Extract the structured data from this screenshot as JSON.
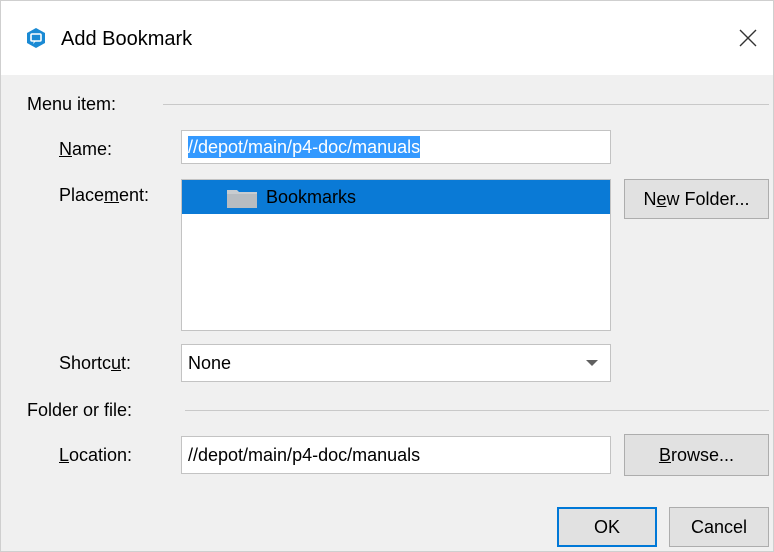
{
  "dialog": {
    "title": "Add Bookmark",
    "icon": "helix-app-icon",
    "close_icon": "close-icon"
  },
  "menu_item_group": {
    "label": "Menu item:",
    "name": {
      "label_pre": "",
      "label_mnemonic": "N",
      "label_post": "ame:",
      "value": "//depot/main/p4-doc/manuals"
    },
    "placement": {
      "label_pre": "Place",
      "label_mnemonic": "m",
      "label_post": "ent:",
      "items": [
        {
          "label": "Bookmarks",
          "icon": "folder-icon",
          "selected": true
        }
      ]
    },
    "new_folder_button": {
      "label_pre": "N",
      "label_mnemonic": "e",
      "label_post": "w Folder..."
    },
    "shortcut": {
      "label_pre": "Shortc",
      "label_mnemonic": "u",
      "label_post": "t:",
      "value": "None"
    }
  },
  "folder_group": {
    "label": "Folder or file:",
    "location": {
      "label_pre": "",
      "label_mnemonic": "L",
      "label_post": "ocation:",
      "value": "//depot/main/p4-doc/manuals"
    },
    "browse_button": {
      "label_pre": "",
      "label_mnemonic": "B",
      "label_post": "rowse..."
    }
  },
  "footer": {
    "ok_label": "OK",
    "cancel_label": "Cancel"
  },
  "colors": {
    "accent": "#0078d7",
    "selection": "#0a7ad6",
    "text_selection": "#3399ff"
  }
}
